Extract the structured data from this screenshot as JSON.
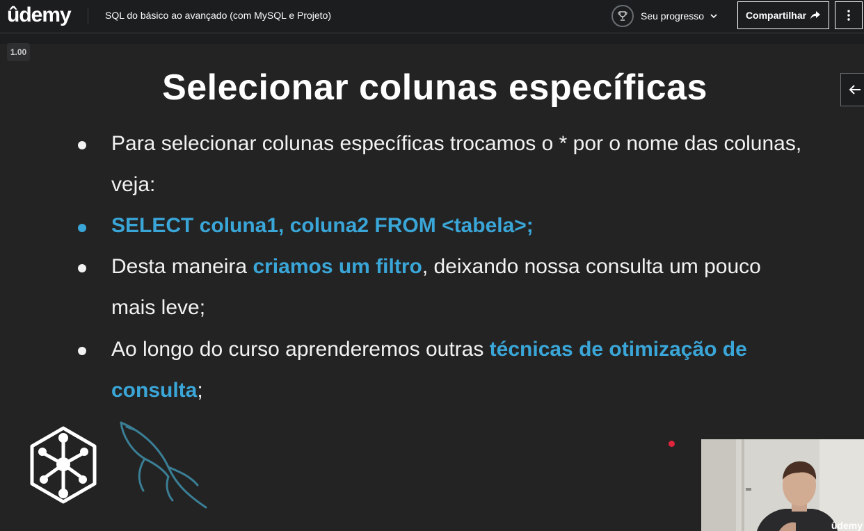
{
  "header": {
    "logo_text": "ûdemy",
    "course_title": "SQL do básico ao avançado (com MySQL e Projeto)",
    "progress_label": "Seu progresso",
    "share_label": "Compartilhar",
    "icons": [
      "trophy-icon",
      "chevron-down-icon",
      "share-arrow-icon",
      "more-vertical-icon"
    ]
  },
  "player": {
    "speed": "1.00",
    "side_icon": "arrow-left-icon",
    "webcam_watermark": "ûdemy"
  },
  "slide": {
    "title": "Selecionar colunas específicas",
    "bullet1_line1": "Para selecionar colunas específicas trocamos o * por o nome das colunas,",
    "bullet1_line2": "veja:",
    "bullet2_code": "SELECT coluna1, coluna2 FROM <tabela>;",
    "bullet3_pre": "Desta maneira ",
    "bullet3_hl": "criamos um filtro",
    "bullet3_post": ", deixando nossa consulta um pouco",
    "bullet3_line2": "mais leve;",
    "bullet4_pre": "Ao longo do curso aprenderemos outras ",
    "bullet4_hl1": "técnicas de otimização de",
    "bullet4_hl2": "consulta",
    "bullet4_post": ";",
    "logos": [
      "cube-network-logo",
      "mysql-dolphin-logo"
    ]
  },
  "colors": {
    "accent_blue": "#3aa6d8",
    "background": "#1c1d1f",
    "slide_bg": "#232323",
    "record_dot": "#e0243c"
  }
}
